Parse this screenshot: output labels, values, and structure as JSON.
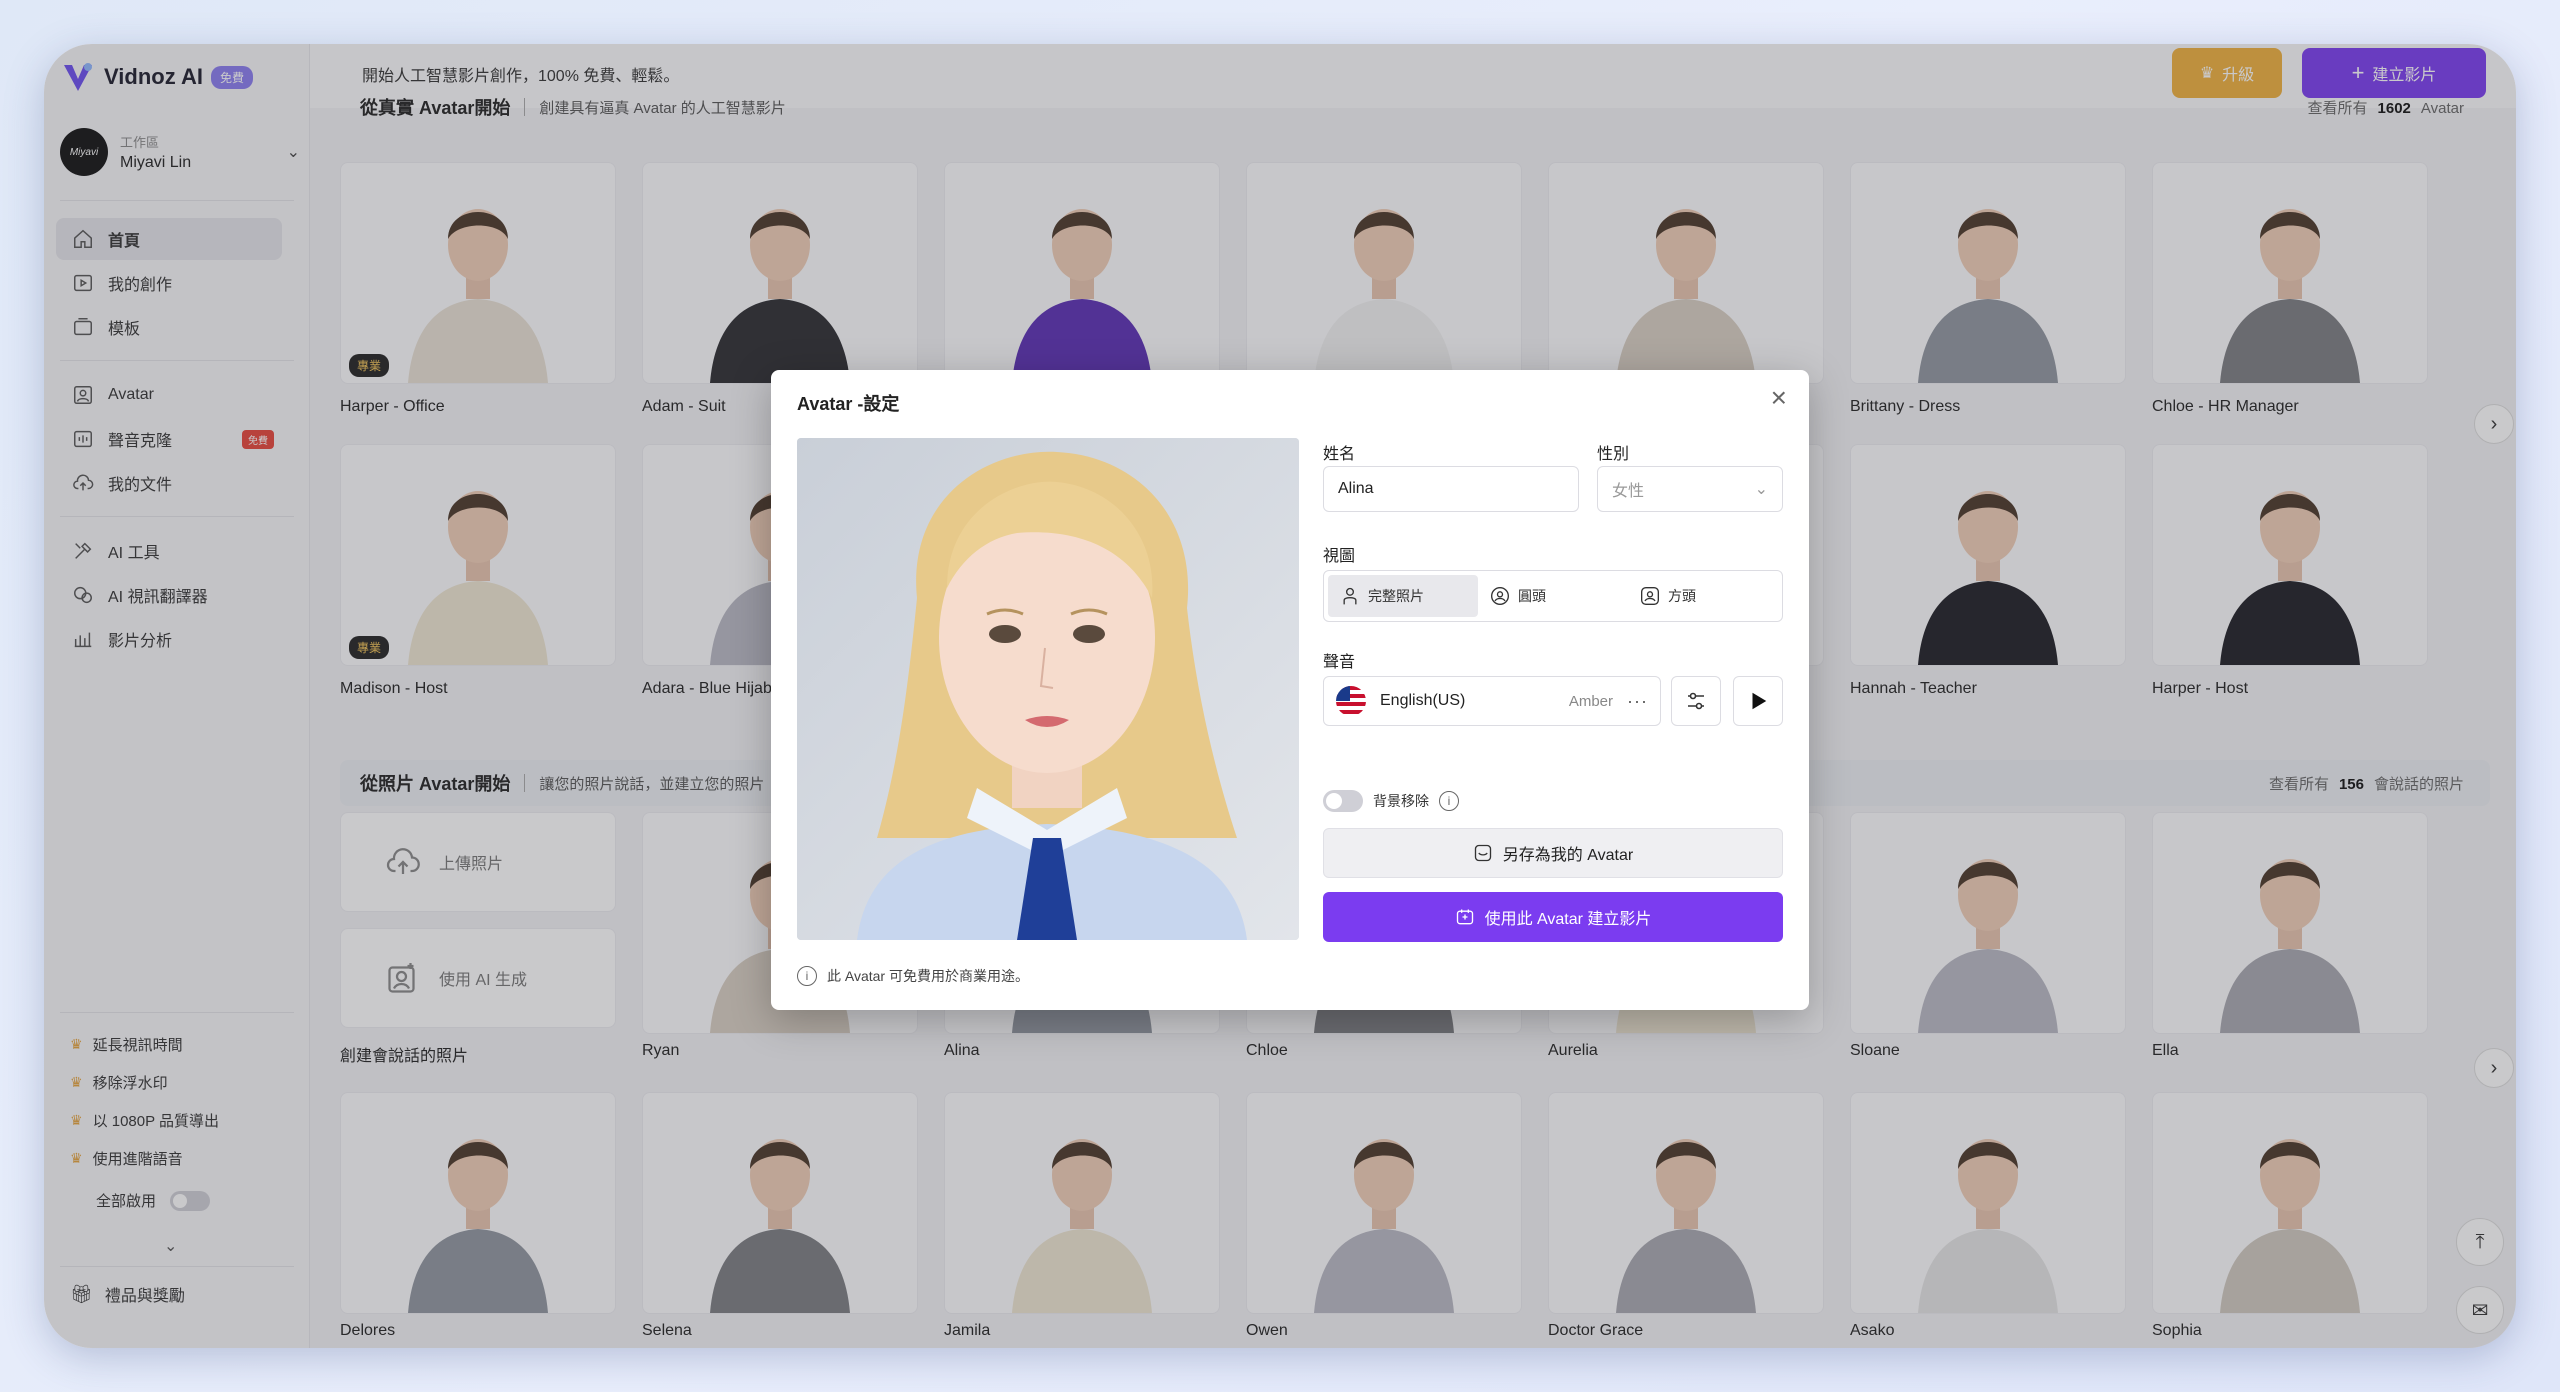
{
  "app": {
    "name": "Vidnoz AI",
    "badge": "免費",
    "tagline": "開始人工智慧影片創作，100% 免費、輕鬆。"
  },
  "workspace": {
    "label": "工作區",
    "name": "Miyavi Lin",
    "avatar_text": "Miyavi"
  },
  "nav": {
    "home": "首頁",
    "my_creations": "我的創作",
    "templates": "模板",
    "avatar": "Avatar",
    "voice_clone": "聲音克隆",
    "voice_clone_tag": "免費",
    "my_files": "我的文件",
    "ai_tools": "AI 工具",
    "ai_translator": "AI 視訊翻譯器",
    "analytics": "影片分析"
  },
  "perks": [
    "延長視訊時間",
    "移除浮水印",
    "以 1080P 品質導出",
    "使用進階語音"
  ],
  "enable_all": "全部啟用",
  "gifts": "禮品與獎勵",
  "top": {
    "upgrade": "升級",
    "create": "建立影片"
  },
  "section1": {
    "title": "從真實 Avatar開始",
    "subtitle": "創建具有逼真 Avatar 的人工智慧影片",
    "view_all": "查看所有",
    "count": "1602",
    "unit": "Avatar"
  },
  "section2": {
    "title": "從照片 Avatar開始",
    "subtitle": "讓您的照片說話，並建立您的照片",
    "view_all": "查看所有",
    "count": "156",
    "unit": "會說話的照片"
  },
  "pro_label": "專業",
  "row1": [
    "Harper - Office",
    "Adam - Suit",
    "",
    "",
    "",
    "Brittany - Dress",
    "Chloe - HR Manager"
  ],
  "row2": [
    "Madison - Host",
    "Adara - Blue Hijab",
    "",
    "",
    "",
    "Hannah - Teacher",
    "Harper - Host"
  ],
  "upload": {
    "upload_photo": "上傳照片",
    "ai_generate": "使用 AI 生成"
  },
  "row3": [
    "創建會說話的照片",
    "Ryan",
    "Alina",
    "Chloe",
    "Aurelia",
    "Sloane",
    "Ella"
  ],
  "row4": [
    "Delores",
    "Selena",
    "Jamila",
    "Owen",
    "Doctor Grace",
    "Asako",
    "Sophia"
  ],
  "modal": {
    "title": "Avatar -設定",
    "name_label": "姓名",
    "name_value": "Alina",
    "gender_label": "性別",
    "gender_value": "女性",
    "view_label": "視圖",
    "views": [
      "完整照片",
      "圓頭",
      "方頭"
    ],
    "voice_label": "聲音",
    "voice_lang": "English(US)",
    "voice_name": "Amber",
    "bg_remove": "背景移除",
    "save_btn": "另存為我的 Avatar",
    "use_btn": "使用此 Avatar 建立影片",
    "note": "此 Avatar 可免費用於商業用途。"
  },
  "colors": {
    "accent": "#7b3cf0",
    "upgrade": "#f0b03c"
  }
}
